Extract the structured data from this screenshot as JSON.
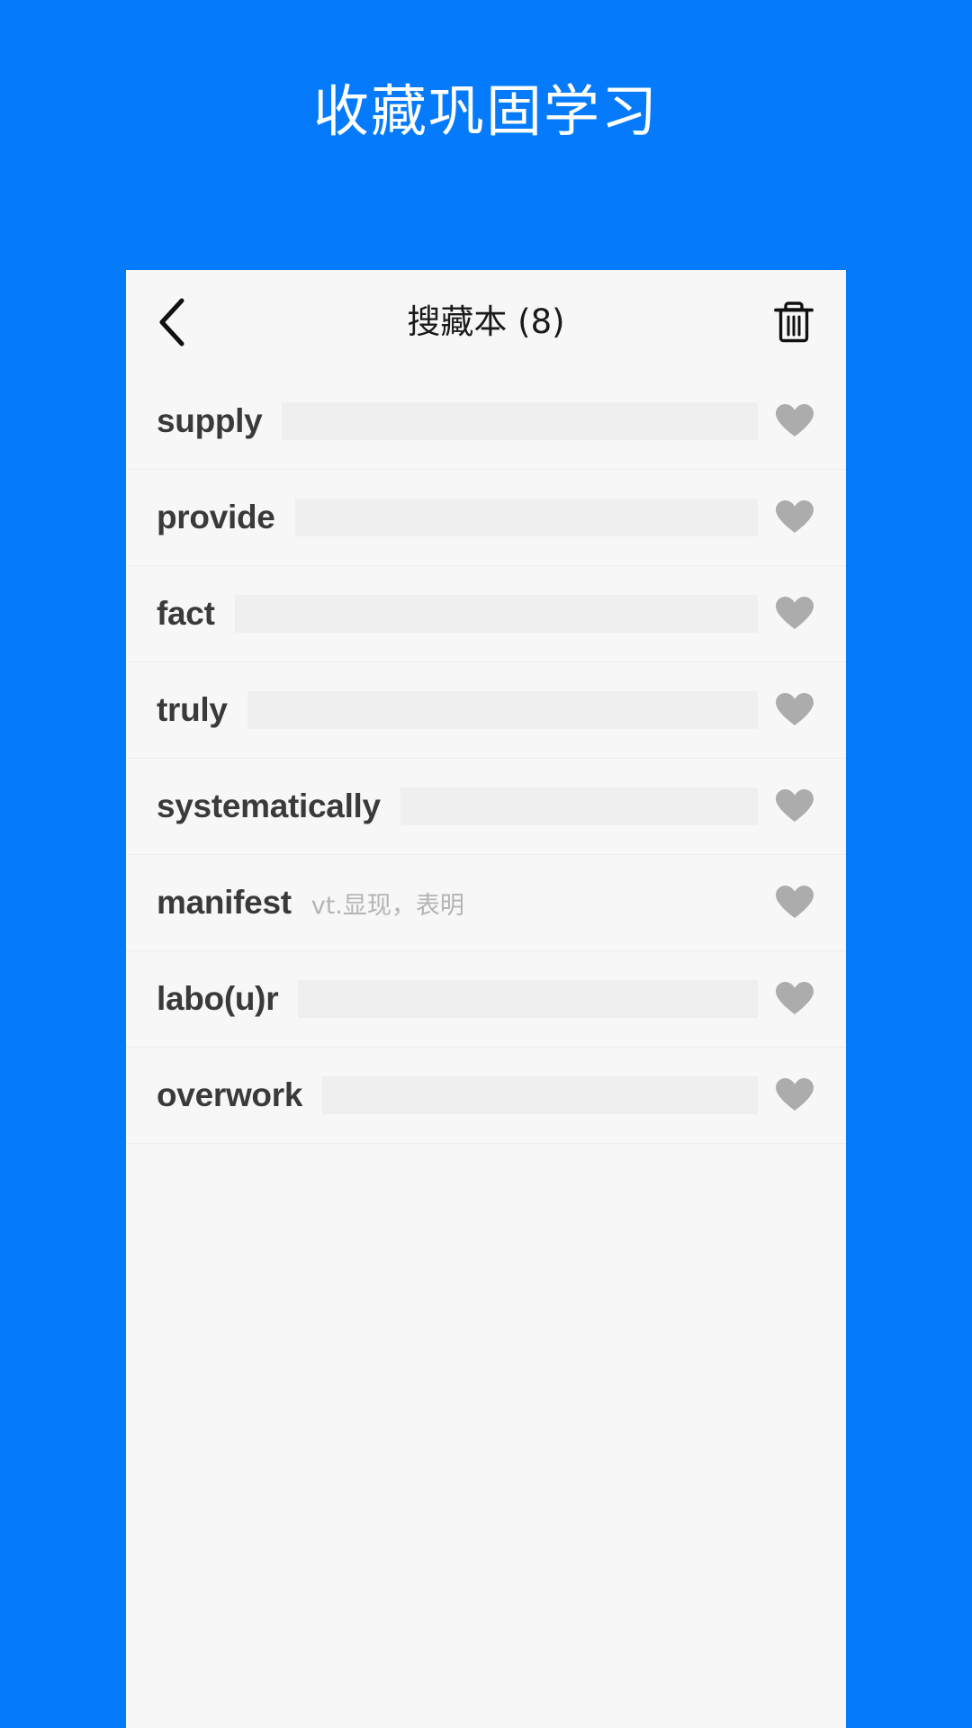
{
  "promo": {
    "headline": "收藏巩固学习"
  },
  "colors": {
    "background_blue": "#057BFC",
    "card_background": "#F7F7F7",
    "word_text": "#3A3A3A",
    "definition_text": "#B4B4B4",
    "definition_mask": "#EFEFEF",
    "heart_gray": "#ACACAC",
    "row_divider": "#ECECEC"
  },
  "navbar": {
    "back_icon": "chevron-left-icon",
    "title": "搜藏本 (8)",
    "delete_icon": "trash-icon"
  },
  "word_list": {
    "count": 8,
    "rows": [
      {
        "term": "supply",
        "definition": "",
        "hidden": true,
        "favorited": true,
        "heart_icon": "heart-filled-icon"
      },
      {
        "term": "provide",
        "definition": "",
        "hidden": true,
        "favorited": true,
        "heart_icon": "heart-filled-icon"
      },
      {
        "term": "fact",
        "definition": "",
        "hidden": true,
        "favorited": true,
        "heart_icon": "heart-filled-icon"
      },
      {
        "term": "truly",
        "definition": "",
        "hidden": true,
        "favorited": true,
        "heart_icon": "heart-filled-icon"
      },
      {
        "term": "systematically",
        "definition": "",
        "hidden": true,
        "favorited": true,
        "heart_icon": "heart-filled-icon"
      },
      {
        "term": "manifest",
        "definition": "vt.显现，表明",
        "hidden": false,
        "favorited": true,
        "heart_icon": "heart-filled-icon"
      },
      {
        "term": "labo(u)r",
        "definition": "",
        "hidden": true,
        "favorited": true,
        "heart_icon": "heart-filled-icon"
      },
      {
        "term": "overwork",
        "definition": "",
        "hidden": true,
        "favorited": true,
        "heart_icon": "heart-filled-icon"
      }
    ]
  }
}
